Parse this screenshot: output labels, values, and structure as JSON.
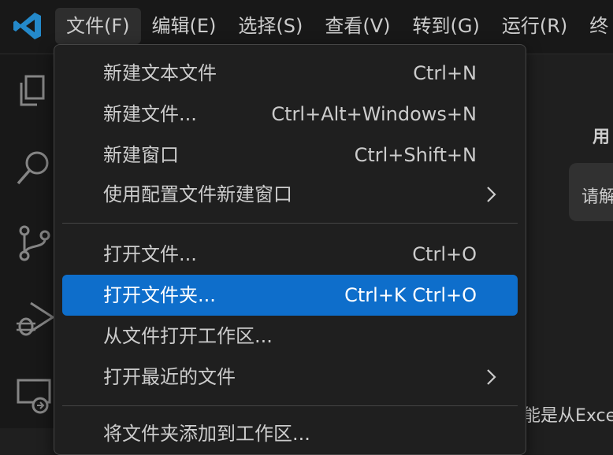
{
  "menubar": {
    "items": [
      "文件(F)",
      "编辑(E)",
      "选择(S)",
      "查看(V)",
      "转到(G)",
      "运行(R)",
      "终"
    ]
  },
  "file_menu": {
    "new_text_file": {
      "label": "新建文本文件",
      "shortcut": "Ctrl+N"
    },
    "new_file": {
      "label": "新建文件...",
      "shortcut": "Ctrl+Alt+Windows+N"
    },
    "new_window": {
      "label": "新建窗口",
      "shortcut": "Ctrl+Shift+N"
    },
    "new_window_profile": {
      "label": "使用配置文件新建窗口"
    },
    "open_file": {
      "label": "打开文件...",
      "shortcut": "Ctrl+O"
    },
    "open_folder": {
      "label": "打开文件夹...",
      "shortcut": "Ctrl+K Ctrl+O"
    },
    "open_workspace": {
      "label": "从文件打开工作区..."
    },
    "open_recent": {
      "label": "打开最近的文件"
    },
    "add_folder_partial": {
      "label": "将文件夹添加到工作区..."
    }
  },
  "background": {
    "heading_partial": "用",
    "box_text_partial": "请解",
    "bottom_text_partial": "能是从Exce"
  },
  "icons": {
    "logo": "vscode-logo-icon",
    "explorer": "files-icon",
    "search": "search-icon",
    "source_control": "source-control-icon",
    "run_debug": "run-debug-icon",
    "remote": "remote-explorer-icon"
  },
  "colors": {
    "accent": "#0e6ecb",
    "logo": "#2489ca",
    "background": "#1f1f1f"
  }
}
